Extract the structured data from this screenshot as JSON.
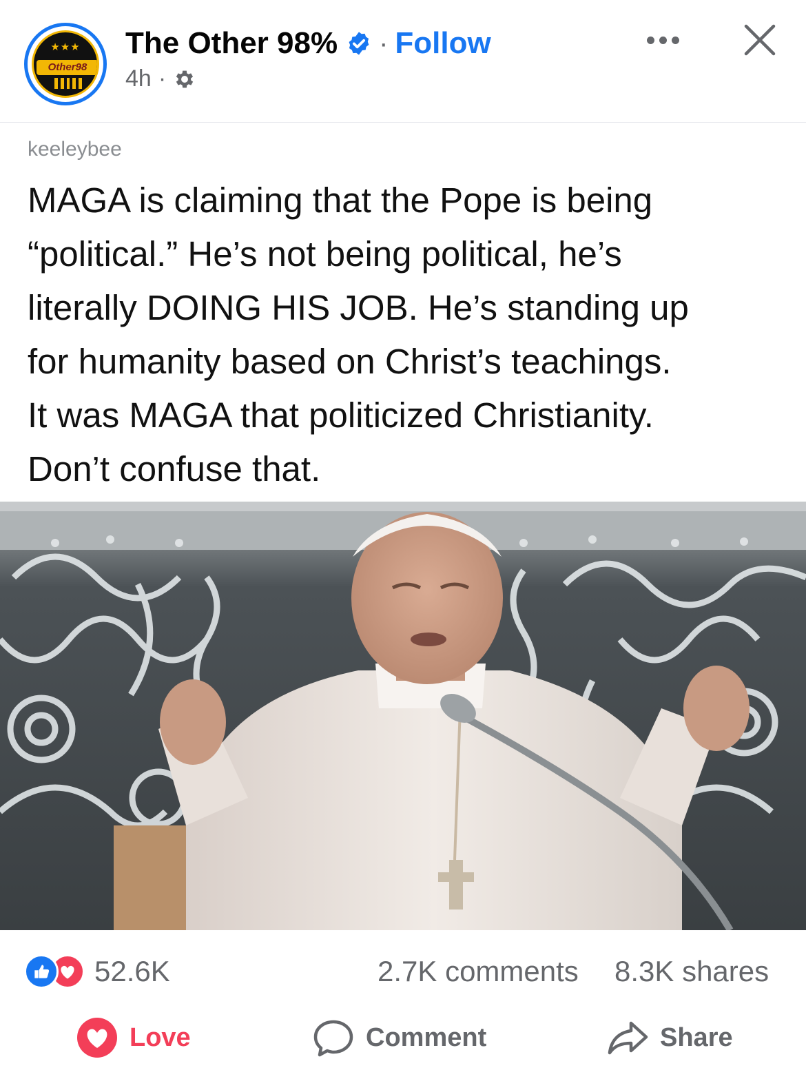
{
  "header": {
    "avatar_text": "Other98",
    "page_name": "The Other 98%",
    "separator": "·",
    "follow_label": "Follow",
    "time": "4h",
    "meta_dot": "·",
    "icons": {
      "verified": "verified-badge-icon",
      "audience": "gear-icon",
      "more": "more-options-icon",
      "close": "close-icon"
    }
  },
  "post": {
    "username": "keeleybee",
    "text": "MAGA is claiming that the Pope is being\n“political.” He’s not being political, he’s\nliterally DOING HIS JOB. He’s standing up\nfor humanity based on Christ’s teachings.\nIt was MAGA that politicized Christianity.\nDon’t confuse that."
  },
  "stats": {
    "reactions_count": "52.6K",
    "comments": "2.7K comments",
    "shares": "8.3K shares"
  },
  "actions": {
    "love_label": "Love",
    "comment_label": "Comment",
    "share_label": "Share"
  },
  "colors": {
    "accent": "#1877f2",
    "love": "#f33e58",
    "muted": "#65676b"
  }
}
